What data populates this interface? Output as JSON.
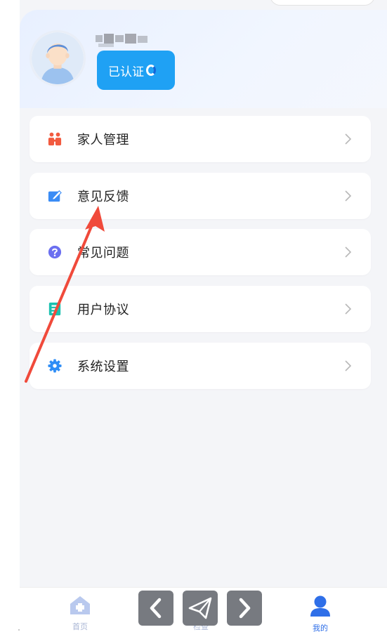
{
  "profile": {
    "verified_label": "已认证"
  },
  "menu": {
    "items": [
      {
        "label": "家人管理",
        "icon": "family-icon"
      },
      {
        "label": "意见反馈",
        "icon": "feedback-edit-icon"
      },
      {
        "label": "常见问题",
        "icon": "question-icon"
      },
      {
        "label": "用户协议",
        "icon": "document-icon"
      },
      {
        "label": "系统设置",
        "icon": "gear-icon"
      }
    ]
  },
  "tabbar": {
    "items": [
      {
        "label": "首页",
        "icon": "home-icon",
        "active": false
      },
      {
        "label": "检查",
        "icon": "check-icon",
        "active": false
      },
      {
        "label": "我的",
        "icon": "user-icon",
        "active": true
      }
    ]
  },
  "colors": {
    "accent": "#1fa1f4",
    "family_icon": "#f25a3f",
    "feedback_icon": "#3a8cf5",
    "question_icon": "#6b6ff0",
    "document_icon": "#1cc1b0",
    "gear_icon": "#2e8df6",
    "annotation_arrow": "#f04a3b"
  }
}
